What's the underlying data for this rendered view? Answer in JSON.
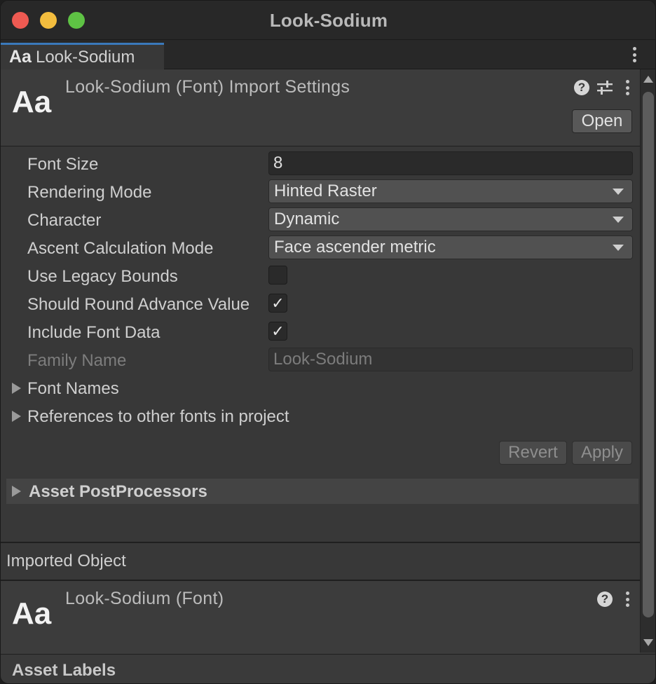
{
  "window": {
    "title": "Look-Sodium"
  },
  "tab": {
    "icon_text": "Aa",
    "label": "Look-Sodium"
  },
  "inspector": {
    "icon_text": "Aa",
    "title": "Look-Sodium (Font) Import Settings",
    "help_icon_text": "?",
    "open_button": "Open",
    "properties": [
      {
        "label": "Font Size",
        "type": "text",
        "value": "8"
      },
      {
        "label": "Rendering Mode",
        "type": "dropdown",
        "value": "Hinted Raster"
      },
      {
        "label": "Character",
        "type": "dropdown",
        "value": "Dynamic"
      },
      {
        "label": "Ascent Calculation Mode",
        "type": "dropdown",
        "value": "Face ascender metric"
      },
      {
        "label": "Use Legacy Bounds",
        "type": "checkbox",
        "checked": false
      },
      {
        "label": "Should Round Advance Value",
        "type": "checkbox",
        "checked": true
      },
      {
        "label": "Include Font Data",
        "type": "checkbox",
        "checked": true
      },
      {
        "label": "Family Name",
        "type": "text",
        "value": "Look-Sodium",
        "disabled": true
      }
    ],
    "foldouts": [
      "Font Names",
      "References to other fonts in project"
    ],
    "check_mark": "✓",
    "revert_button": "Revert",
    "apply_button": "Apply",
    "postprocessors_label": "Asset PostProcessors"
  },
  "imported": {
    "section_label": "Imported Object",
    "icon_text": "Aa",
    "title": "Look-Sodium (Font)",
    "help_icon_text": "?"
  },
  "asset_labels": {
    "title": "Asset Labels"
  },
  "colors": {
    "accent": "#3a79bb",
    "close": "#ee5a52",
    "minimize": "#f3bd3e",
    "zoom": "#5ec244"
  }
}
